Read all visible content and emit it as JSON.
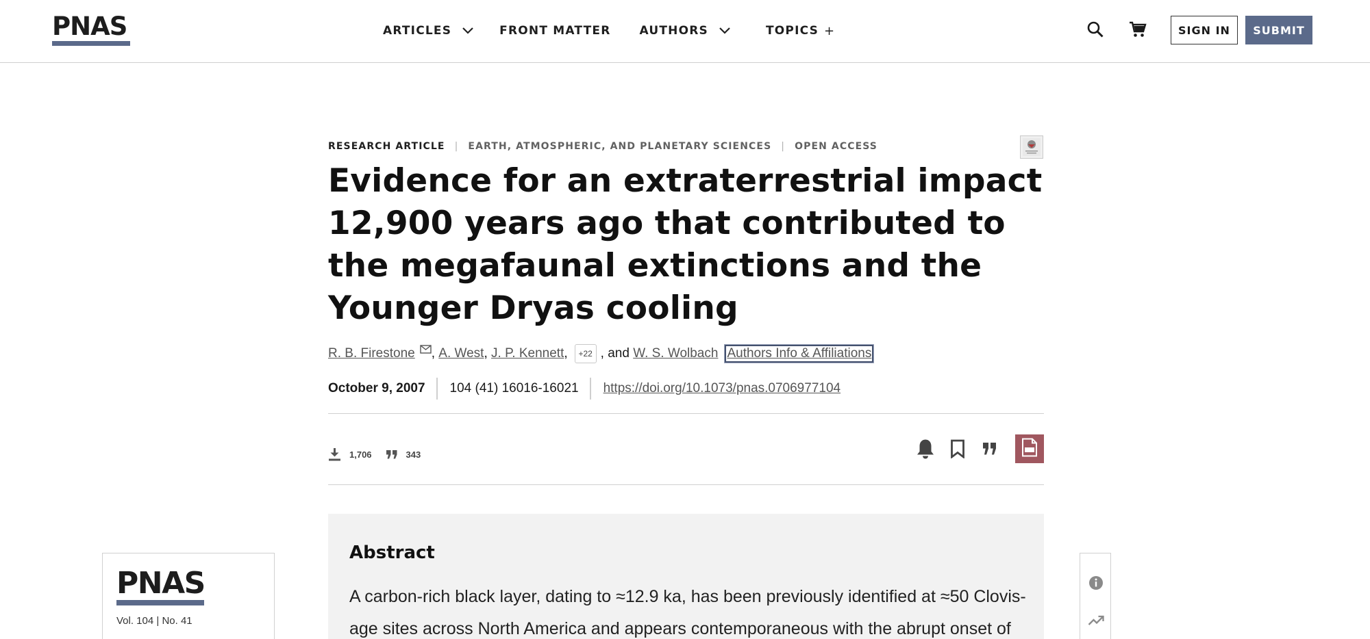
{
  "header": {
    "logo": "PNAS",
    "nav": [
      {
        "label": "ARTICLES",
        "icon": "chevron-down-icon"
      },
      {
        "label": "FRONT MATTER"
      },
      {
        "label": "AUTHORS",
        "icon": "chevron-down-icon"
      },
      {
        "label": "TOPICS",
        "icon": "plus-icon",
        "glyph": "+"
      }
    ],
    "search_icon": "search-icon",
    "cart_icon": "cart-icon",
    "sign_in": "SIGN IN",
    "submit": "SUBMIT"
  },
  "article": {
    "type": "RESEARCH ARTICLE",
    "section": "EARTH, ATMOSPHERIC, AND PLANETARY SCIENCES",
    "access": "OPEN ACCESS",
    "separator": "|",
    "title": "Evidence for an extraterrestrial impact 12,900 years ago that contributed to the megafaunal extinctions and the Younger Dryas cooling",
    "authors": {
      "first": "R. B. Firestone",
      "second": "A. West",
      "third": "J. P. Kennett",
      "more": "+22",
      "and": ", and",
      "last": "W. S. Wolbach",
      "comma": ",",
      "affiliations_link": "Authors Info & Affiliations"
    },
    "date": "October 9, 2007",
    "citation": "104 (41) 16016-16021",
    "doi": "https://doi.org/10.1073/pnas.0706977104",
    "metrics": {
      "downloads": "1,706",
      "citations": "343"
    },
    "tools": [
      "bell-icon",
      "bookmark-icon",
      "quote-icon",
      "pdf-icon"
    ]
  },
  "abstract": {
    "heading": "Abstract",
    "text": "A carbon-rich black layer, dating to ≈12.9 ka, has been previously identified at ≈50 Clovis-age sites across North America and appears contemporaneous with the abrupt onset of"
  },
  "journal_card": {
    "logo": "PNAS",
    "volume": "Vol. 104 | No. 41"
  },
  "colors": {
    "accent": "#5b6a8a",
    "pdf": "#a0575f",
    "abstract_bg": "#f2f2f2"
  }
}
